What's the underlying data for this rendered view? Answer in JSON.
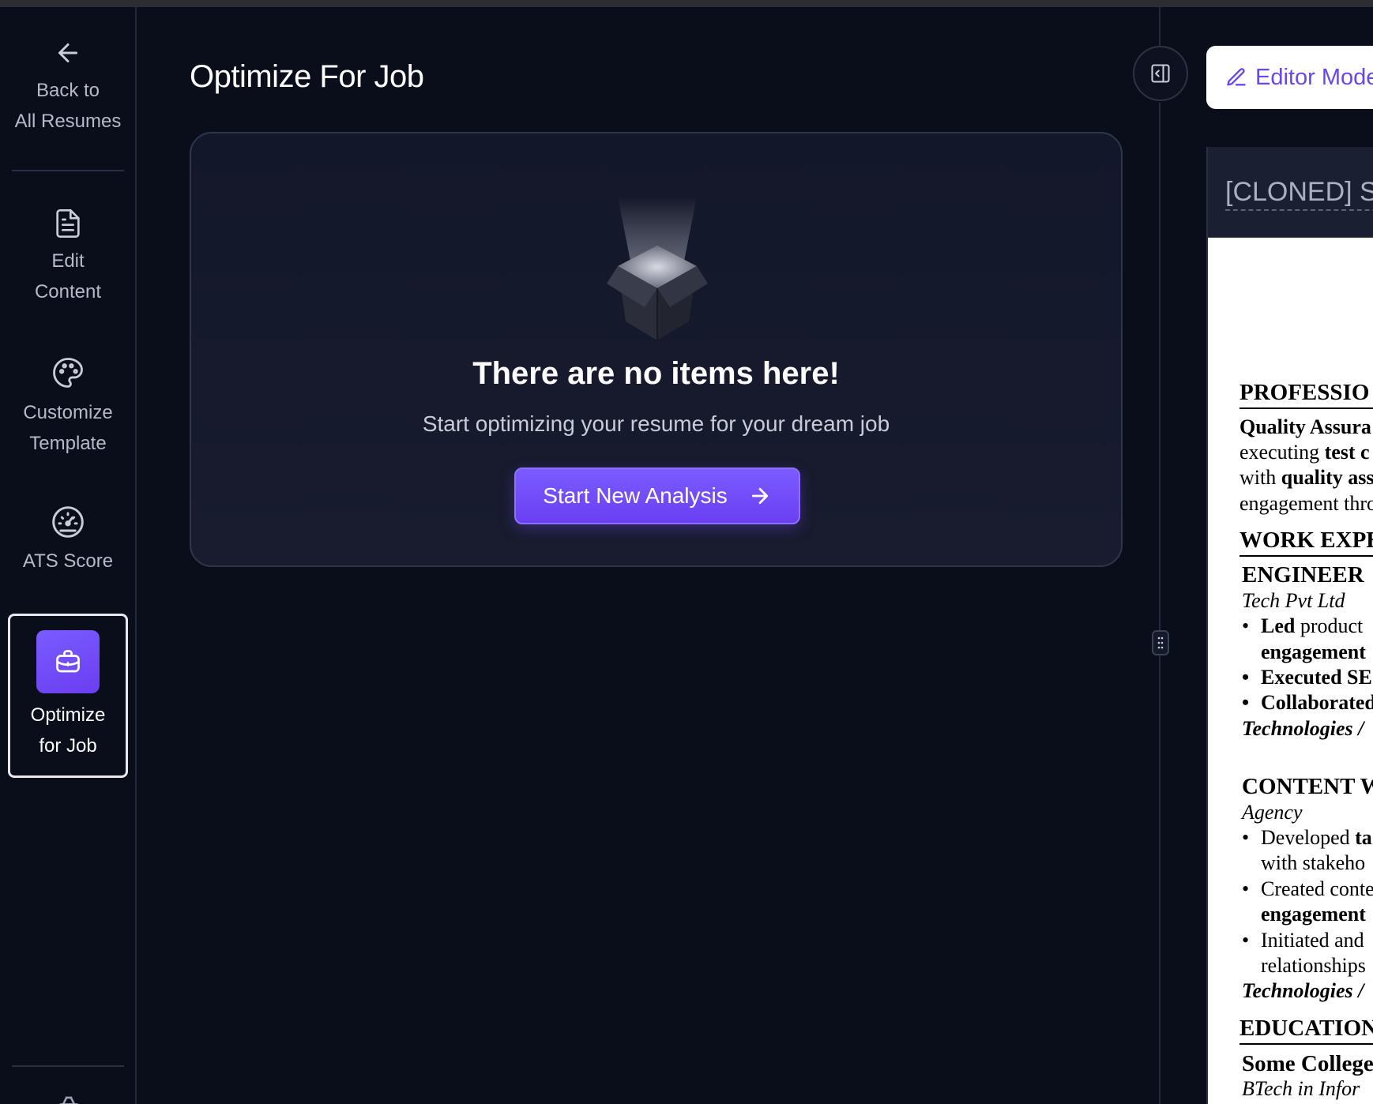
{
  "sidebar": {
    "back": "Back to\nAll Resumes",
    "items": [
      {
        "icon": "file-text-icon",
        "label": "Edit\nContent"
      },
      {
        "icon": "palette-icon",
        "label": "Customize\nTemplate"
      },
      {
        "icon": "gauge-icon",
        "label": "ATS Score"
      },
      {
        "icon": "briefcase-icon",
        "label": "Optimize\nfor Job",
        "active": true
      }
    ]
  },
  "main": {
    "title": "Optimize For Job",
    "empty_state": {
      "title": "There are no items here!",
      "subtitle": "Start optimizing your resume for your dream job",
      "button": "Start New Analysis"
    }
  },
  "preview": {
    "editor_mode_label": "Editor Mode",
    "resume_name": "[CLONED] Sa",
    "lines": [
      {
        "id": "s1",
        "text": "PROFESSIO"
      },
      {
        "id": "p1a_b",
        "text": "Quality Assura"
      },
      {
        "id": "p1b",
        "text": "executing "
      },
      {
        "id": "p1b_b",
        "text": "test c"
      },
      {
        "id": "p1c",
        "text": "with "
      },
      {
        "id": "p1c_b",
        "text": "quality ass"
      },
      {
        "id": "p1d",
        "text": "engagement thro"
      },
      {
        "id": "s2",
        "text": "WORK EXPE"
      },
      {
        "id": "j1",
        "text": "ENGINEER"
      },
      {
        "id": "c1",
        "text": "Tech Pvt Ltd"
      },
      {
        "id": "b1_b",
        "text": "Led"
      },
      {
        "id": "b1",
        "text": " product"
      },
      {
        "id": "b1c_b",
        "text": "engagement"
      },
      {
        "id": "b2_b",
        "text": "Executed SE"
      },
      {
        "id": "b3_b",
        "text": "Collaborated"
      },
      {
        "id": "t1",
        "text": "Technologies /"
      },
      {
        "id": "j2",
        "text": "CONTENT W"
      },
      {
        "id": "c2",
        "text": "Agency"
      },
      {
        "id": "b4",
        "text": "Developed "
      },
      {
        "id": "b4_b",
        "text": "ta"
      },
      {
        "id": "b4c",
        "text": "with stakeho"
      },
      {
        "id": "b5",
        "text": "Created conte"
      },
      {
        "id": "b5c_b",
        "text": "engagement"
      },
      {
        "id": "b6",
        "text": "Initiated and"
      },
      {
        "id": "b6c",
        "text": "relationships"
      },
      {
        "id": "t2",
        "text": "Technologies /"
      },
      {
        "id": "s3",
        "text": "EDUCATION"
      },
      {
        "id": "e1",
        "text": "Some College"
      },
      {
        "id": "e2",
        "text": "BTech in Infor"
      }
    ]
  },
  "colors": {
    "accent": "#6a45f2",
    "background": "#0a0e1b",
    "card": "#161a2c"
  }
}
